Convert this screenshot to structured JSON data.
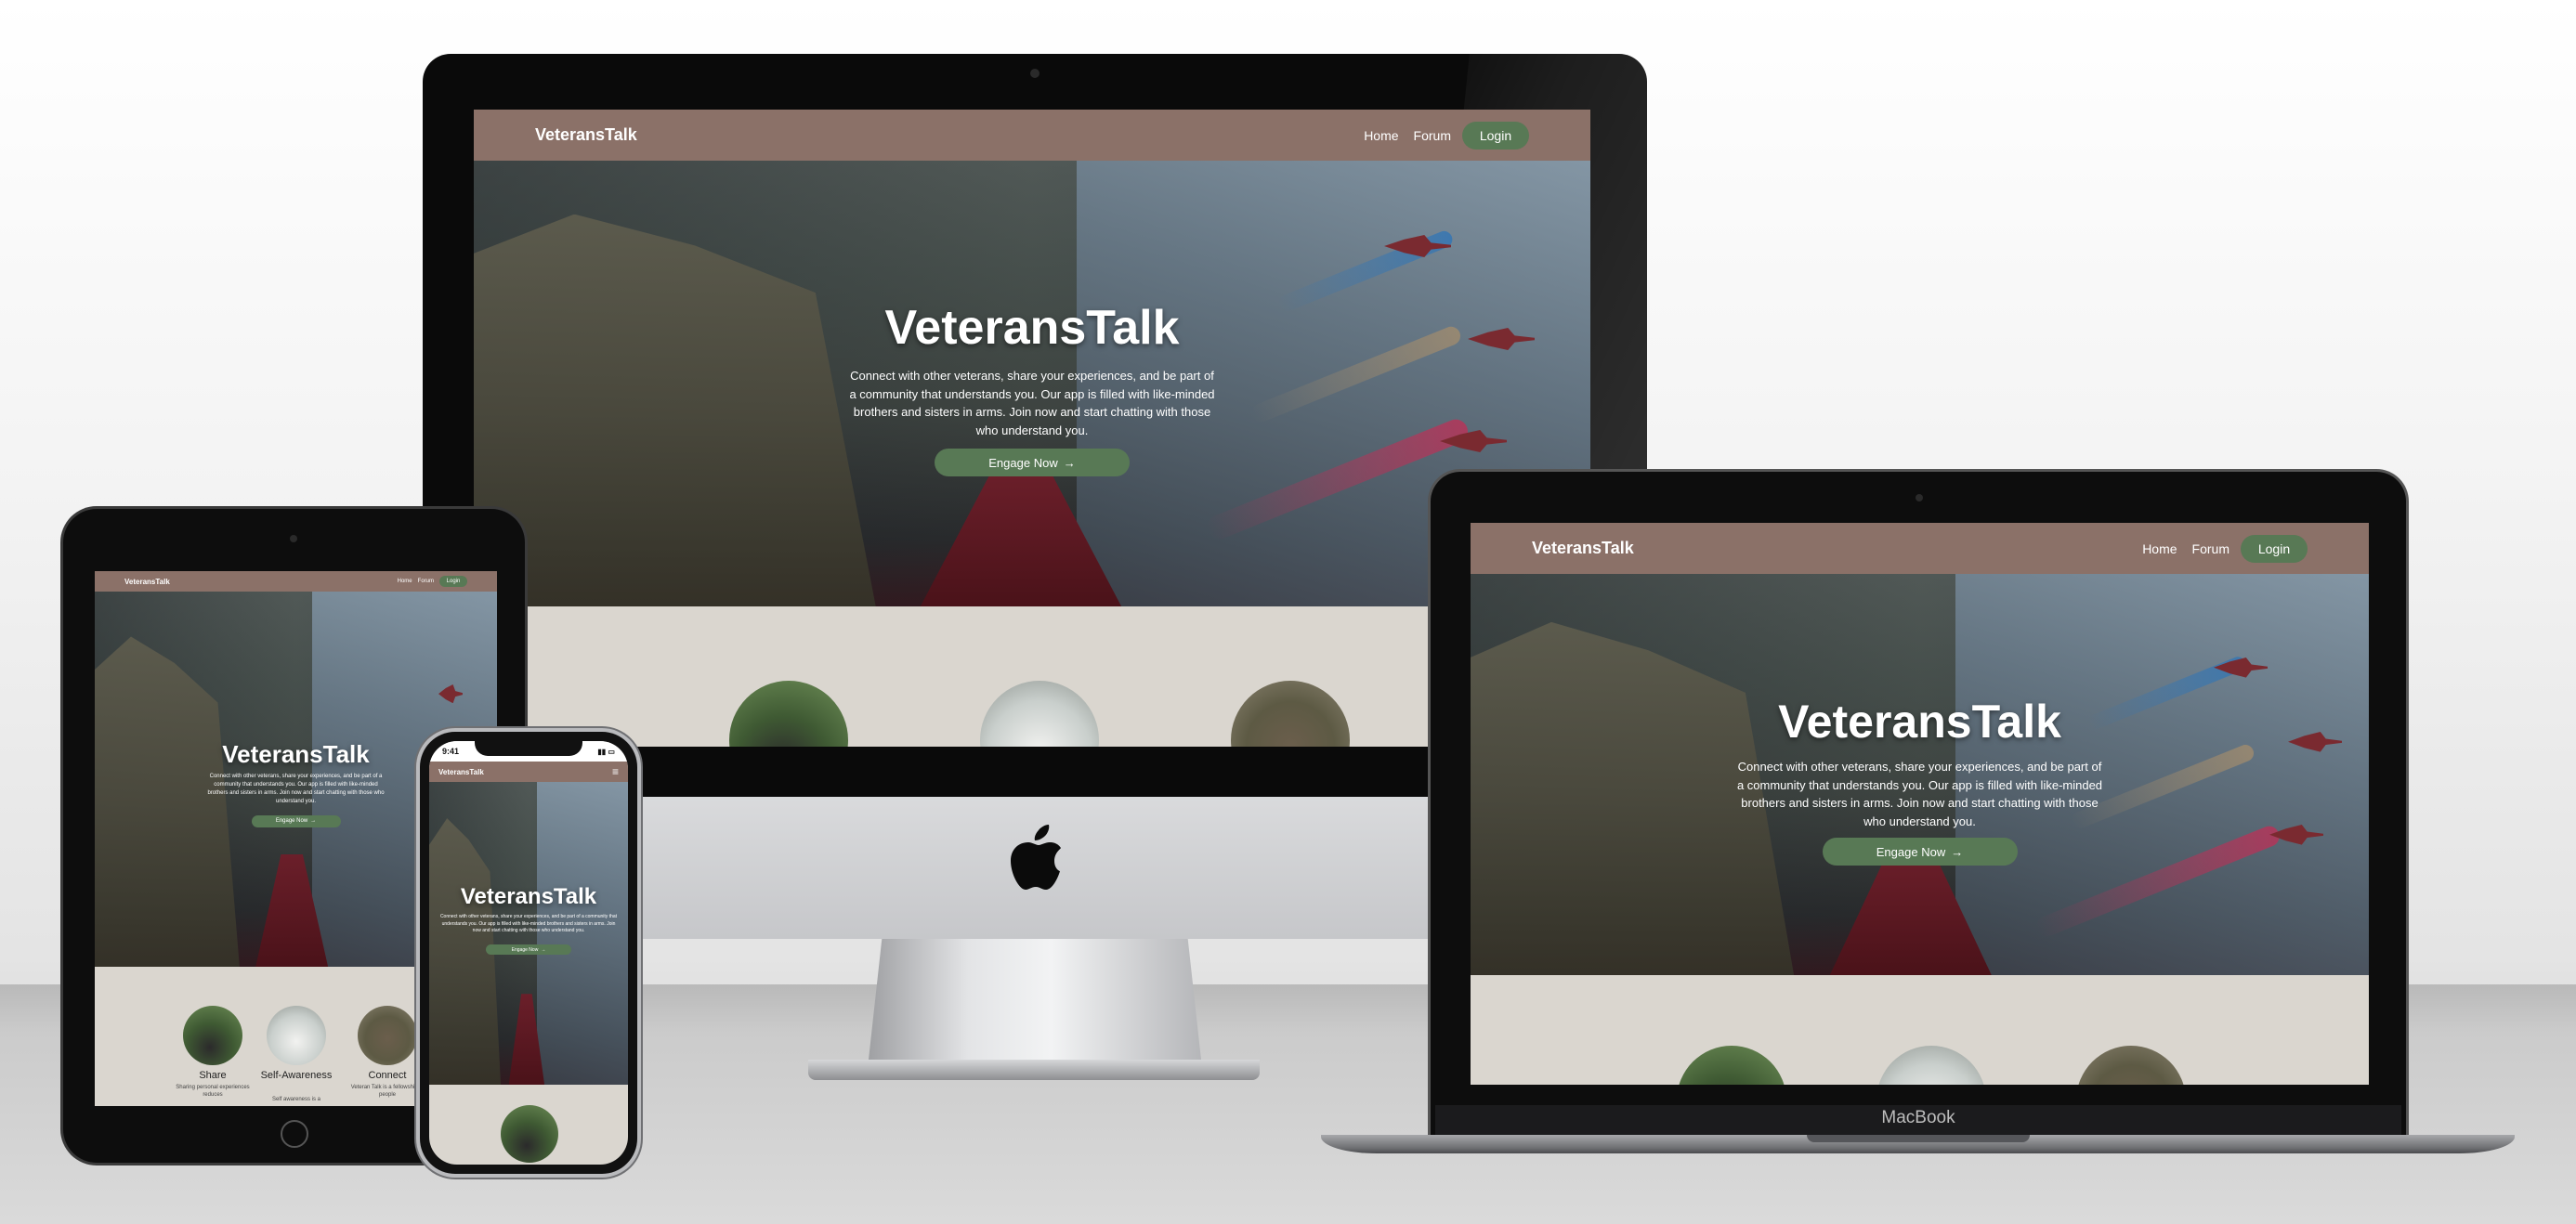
{
  "site": {
    "brand": "VeteransTalk",
    "nav": {
      "home": "Home",
      "forum": "Forum",
      "login": "Login"
    },
    "hero": {
      "title": "VeteransTalk",
      "text": "Connect with other veterans, share your experiences, and be part of a community that understands you. Our app is filled with like-minded brothers and sisters in arms. Join now and start chatting with those who understand you.",
      "cta": "Engage Now",
      "cta_icon": "→"
    },
    "features": [
      {
        "title": "Share",
        "text": "Sharing personal experiences reduces"
      },
      {
        "title": "Self-Awareness",
        "text": "Self awareness is a"
      },
      {
        "title": "Connect",
        "text": "Veteran Talk is a fellowship of people"
      }
    ]
  },
  "devices": {
    "phone_time": "9:41",
    "phone_menu_icon": "menu-icon",
    "laptop_brand": "MacBook"
  },
  "colors": {
    "nav_bg": "#8b7168",
    "accent_green": "#587955",
    "section_bg": "#dad6cf"
  }
}
